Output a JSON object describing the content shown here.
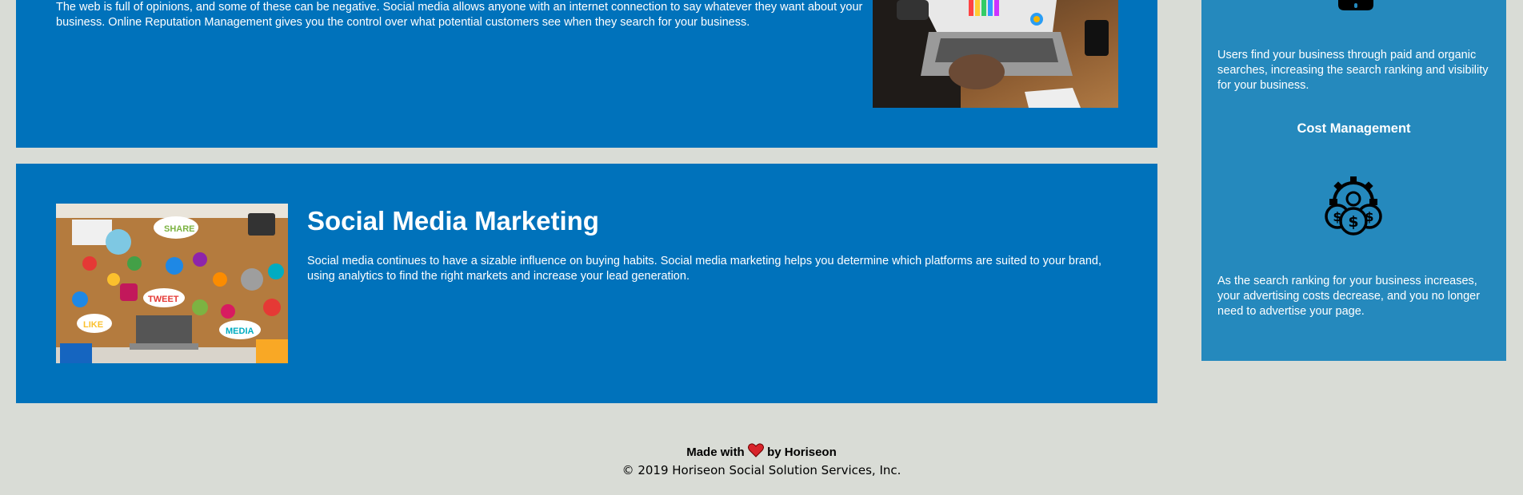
{
  "sections": {
    "reputation": {
      "text": "The web is full of opinions, and some of these can be negative. Social media allows anyone with an internet connection to say whatever they want about your business. Online Reputation Management gives you the control over what potential customers see when they search for your business."
    },
    "social": {
      "title": "Social Media Marketing",
      "text": "Social media continues to have a sizable influence on buying habits. Social media marketing helps you determine which platforms are suited to your brand, using analytics to find the right markets and increase your lead generation.",
      "image_stickers": [
        "SHARE",
        "TWEET",
        "LIKE",
        "MEDIA"
      ]
    }
  },
  "sidebar": {
    "lead_text": "Users find your business through paid and organic searches, increasing the search ranking and visibility for your business.",
    "cost": {
      "heading": "Cost Management",
      "text": "As the search ranking for your business increases, your advertising costs decrease, and you no longer need to advertise your page."
    }
  },
  "footer": {
    "made_prefix": "Made with",
    "made_suffix": "by Horiseon",
    "copyright": "© 2019 Horiseon Social Solution Services, Inc."
  },
  "colors": {
    "background": "#d9dcd6",
    "card": "#0072bb",
    "sidebar": "#2589bd",
    "heart": "#d8232a"
  },
  "icons": [
    "cost-management-icon",
    "heart-icon",
    "search-engine-icon"
  ]
}
